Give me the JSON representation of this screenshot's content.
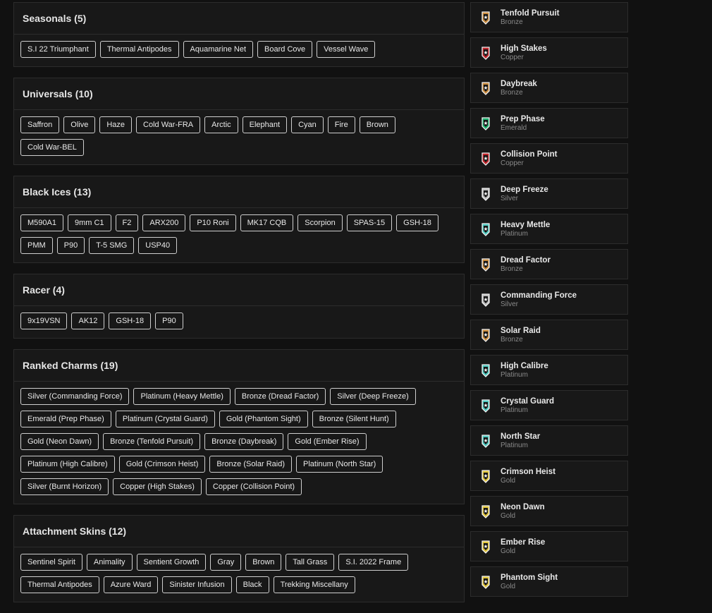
{
  "sections": [
    {
      "title": "Seasonals (5)",
      "items": [
        "S.I 22 Triumphant",
        "Thermal Antipodes",
        "Aquamarine Net",
        "Board Cove",
        "Vessel Wave"
      ]
    },
    {
      "title": "Universals (10)",
      "items": [
        "Saffron",
        "Olive",
        "Haze",
        "Cold War-FRA",
        "Arctic",
        "Elephant",
        "Cyan",
        "Fire",
        "Brown",
        "Cold War-BEL"
      ]
    },
    {
      "title": "Black Ices (13)",
      "items": [
        "M590A1",
        "9mm C1",
        "F2",
        "ARX200",
        "P10 Roni",
        "MK17 CQB",
        "Scorpion",
        "SPAS-15",
        "GSH-18",
        "PMM",
        "P90",
        "T-5 SMG",
        "USP40"
      ]
    },
    {
      "title": "Racer (4)",
      "items": [
        "9x19VSN",
        "AK12",
        "GSH-18",
        "P90"
      ]
    },
    {
      "title": "Ranked Charms (19)",
      "items": [
        "Silver (Commanding Force)",
        "Platinum (Heavy Mettle)",
        "Bronze (Dread Factor)",
        "Silver (Deep Freeze)",
        "Emerald (Prep Phase)",
        "Platinum (Crystal Guard)",
        "Gold (Phantom Sight)",
        "Bronze (Silent Hunt)",
        "Gold (Neon Dawn)",
        "Bronze (Tenfold Pursuit)",
        "Bronze (Daybreak)",
        "Gold (Ember Rise)",
        "Platinum (High Calibre)",
        "Gold (Crimson Heist)",
        "Bronze (Solar Raid)",
        "Platinum (North Star)",
        "Silver (Burnt Horizon)",
        "Copper (High Stakes)",
        "Copper (Collision Point)"
      ]
    },
    {
      "title": "Attachment Skins (12)",
      "items": [
        "Sentinel Spirit",
        "Animality",
        "Sentient Growth",
        "Gray",
        "Brown",
        "Tall Grass",
        "S.I. 2022 Frame",
        "Thermal Antipodes",
        "Azure Ward",
        "Sinister Infusion",
        "Black",
        "Trekking Miscellany"
      ]
    }
  ],
  "seasons": [
    {
      "name": "Tenfold Pursuit",
      "rank": "Bronze",
      "icon": "rank-badge-icon",
      "color": "#c98a3c"
    },
    {
      "name": "High Stakes",
      "rank": "Copper",
      "icon": "rank-badge-icon",
      "color": "#c0242a"
    },
    {
      "name": "Daybreak",
      "rank": "Bronze",
      "icon": "rank-badge-icon",
      "color": "#c98a3c"
    },
    {
      "name": "Prep Phase",
      "rank": "Emerald",
      "icon": "rank-badge-icon",
      "color": "#1fb370"
    },
    {
      "name": "Collision Point",
      "rank": "Copper",
      "icon": "rank-badge-icon",
      "color": "#c0242a"
    },
    {
      "name": "Deep Freeze",
      "rank": "Silver",
      "icon": "rank-badge-icon",
      "color": "#bdbdbd"
    },
    {
      "name": "Heavy Mettle",
      "rank": "Platinum",
      "icon": "rank-badge-icon",
      "color": "#4fc9c0"
    },
    {
      "name": "Dread Factor",
      "rank": "Bronze",
      "icon": "rank-badge-icon",
      "color": "#c98a3c"
    },
    {
      "name": "Commanding Force",
      "rank": "Silver",
      "icon": "rank-badge-icon",
      "color": "#bdbdbd"
    },
    {
      "name": "Solar Raid",
      "rank": "Bronze",
      "icon": "rank-badge-icon",
      "color": "#c98a3c"
    },
    {
      "name": "High Calibre",
      "rank": "Platinum",
      "icon": "rank-badge-icon",
      "color": "#4fc9c0"
    },
    {
      "name": "Crystal Guard",
      "rank": "Platinum",
      "icon": "rank-badge-icon",
      "color": "#4fc9c0"
    },
    {
      "name": "North Star",
      "rank": "Platinum",
      "icon": "rank-badge-icon",
      "color": "#4fc9c0"
    },
    {
      "name": "Crimson Heist",
      "rank": "Gold",
      "icon": "rank-badge-icon",
      "color": "#e0c43a"
    },
    {
      "name": "Neon Dawn",
      "rank": "Gold",
      "icon": "rank-badge-icon",
      "color": "#e0c43a"
    },
    {
      "name": "Ember Rise",
      "rank": "Gold",
      "icon": "rank-badge-icon",
      "color": "#e0c43a"
    },
    {
      "name": "Phantom Sight",
      "rank": "Gold",
      "icon": "rank-badge-icon",
      "color": "#e0c43a"
    }
  ]
}
